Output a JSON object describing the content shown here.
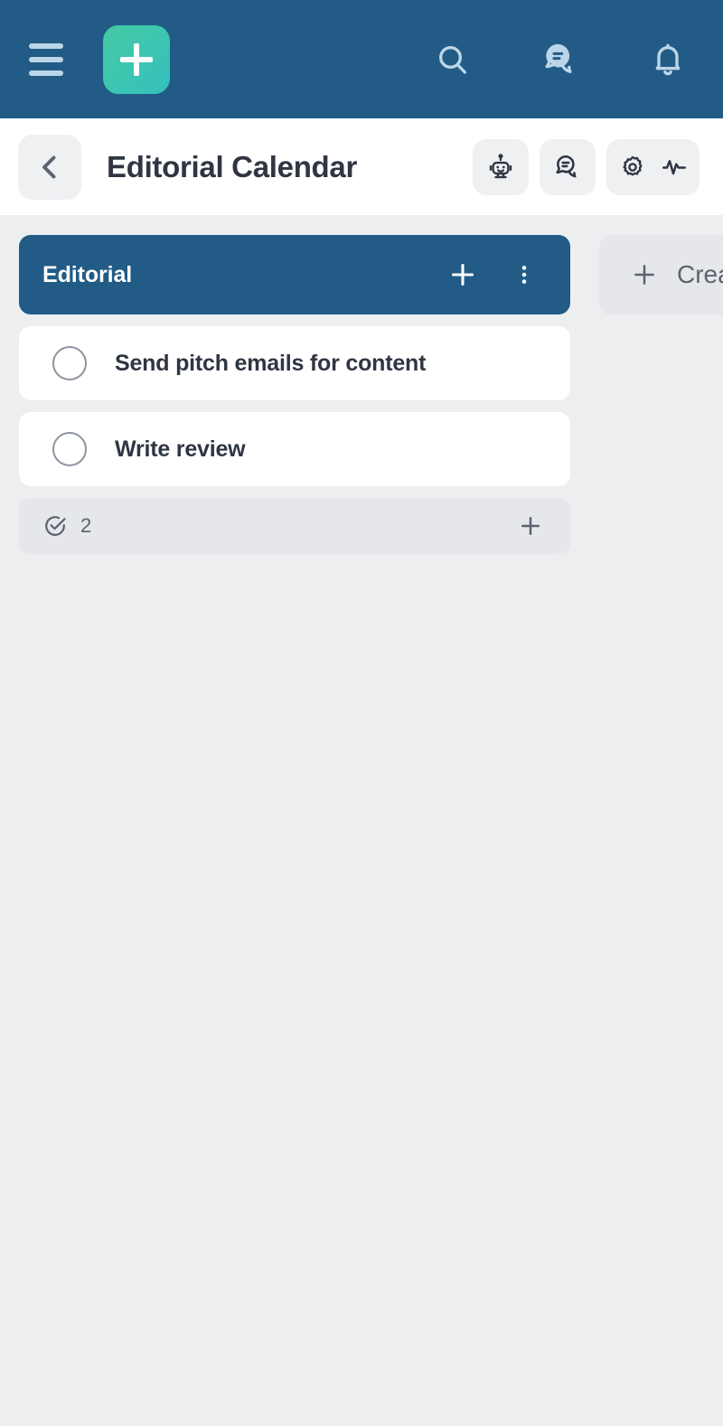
{
  "topbar": {
    "menu_icon": "hamburger-menu-icon",
    "add_label": "+",
    "add_icon": "plus-icon",
    "search_icon": "search-icon",
    "chat_icon": "chat-bubbles-icon",
    "notifications_icon": "bell-icon",
    "background_color": "#215b86",
    "add_button_color": "#3cc6b0"
  },
  "header": {
    "back_icon": "chevron-left-icon",
    "title": "Editorial Calendar",
    "actions": [
      {
        "name": "robot-icon"
      },
      {
        "name": "chat-bubble-icon"
      },
      {
        "name": "gear-icon"
      },
      {
        "name": "activity-pulse-icon"
      }
    ]
  },
  "board": {
    "background_color": "#eceef0",
    "list": {
      "title": "Editorial",
      "header_color": "#215b86",
      "add_task_icon": "plus-icon",
      "menu_icon": "three-dots-vertical-icon",
      "tasks": [
        {
          "label": "Send pitch emails for content",
          "checked": false
        },
        {
          "label": "Write review",
          "checked": false
        }
      ],
      "footer": {
        "count_icon": "check-circle-icon",
        "count": "2",
        "add_icon": "plus-icon"
      }
    },
    "create_list": {
      "icon": "plus-icon",
      "label": "Create"
    }
  }
}
